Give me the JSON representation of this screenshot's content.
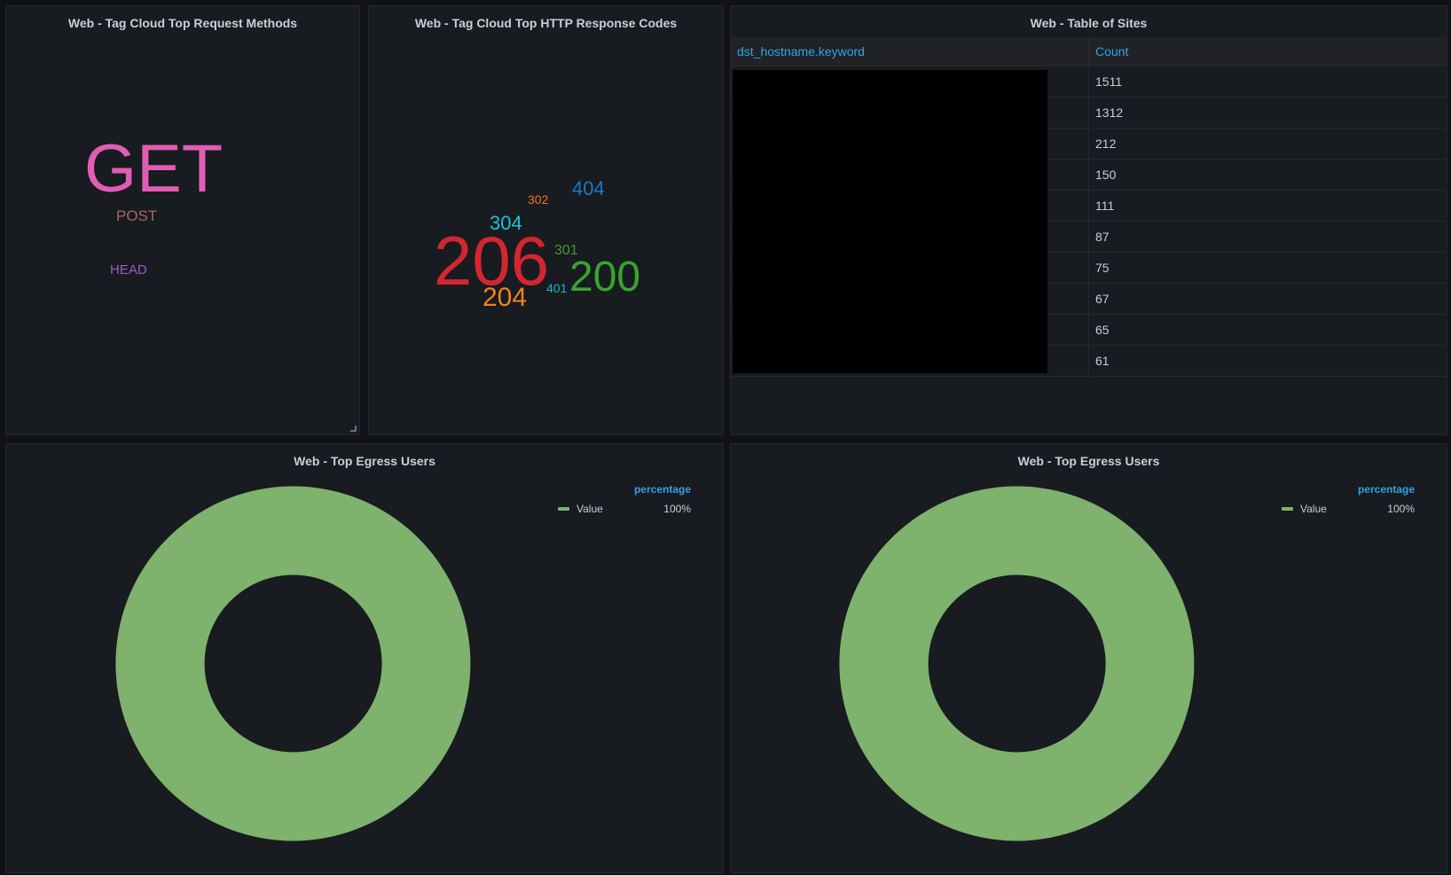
{
  "panels": {
    "methods": {
      "title": "Web - Tag Cloud Top Request Methods",
      "words": [
        {
          "text": "GET",
          "color": "#e05db3"
        },
        {
          "text": "POST",
          "color": "#b0655e"
        },
        {
          "text": "HEAD",
          "color": "#9d5cc7"
        }
      ]
    },
    "codes": {
      "title": "Web - Tag Cloud Top HTTP Response Codes",
      "words": [
        {
          "text": "404",
          "color": "#1f78c1"
        },
        {
          "text": "302",
          "color": "#f2701e"
        },
        {
          "text": "304",
          "color": "#18c4d8"
        },
        {
          "text": "206",
          "color": "#d42630"
        },
        {
          "text": "301",
          "color": "#3c9c34"
        },
        {
          "text": "200",
          "color": "#37a52e"
        },
        {
          "text": "401",
          "color": "#18b4d8"
        },
        {
          "text": "204",
          "color": "#f2821e"
        }
      ]
    },
    "sites": {
      "title": "Web - Table of Sites",
      "columns": [
        "dst_hostname.keyword",
        "Count"
      ],
      "rows": [
        {
          "host": "",
          "count": "1511"
        },
        {
          "host": "",
          "count": "1312"
        },
        {
          "host": "",
          "count": "212"
        },
        {
          "host": "",
          "count": "150"
        },
        {
          "host": "",
          "count": "111"
        },
        {
          "host": "",
          "count": "87"
        },
        {
          "host": "",
          "count": "75"
        },
        {
          "host": "",
          "count": "67"
        },
        {
          "host": "",
          "count": "65"
        },
        {
          "host": "",
          "count": "61"
        }
      ]
    },
    "egress_left": {
      "title": "Web - Top Egress Users",
      "legend_header": "percentage",
      "legend": [
        {
          "label": "Value",
          "percent": "100%",
          "color": "#7eb26d"
        }
      ]
    },
    "egress_right": {
      "title": "Web - Top Egress Users",
      "legend_header": "percentage",
      "legend": [
        {
          "label": "Value",
          "percent": "100%",
          "color": "#7eb26d"
        }
      ]
    }
  },
  "chart_data": [
    {
      "type": "pie",
      "title": "Web - Top Egress Users",
      "categories": [
        "Value"
      ],
      "values": [
        100
      ]
    },
    {
      "type": "pie",
      "title": "Web - Top Egress Users",
      "categories": [
        "Value"
      ],
      "values": [
        100
      ]
    }
  ]
}
